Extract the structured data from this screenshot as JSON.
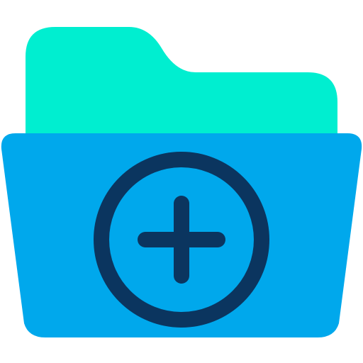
{
  "icon": {
    "name": "add-folder-icon",
    "glyph": "folder with plus sign"
  },
  "colors": {
    "folder_back": "#00EED0",
    "folder_front": "#00A8EC",
    "plus_and_ring": "#0B355F"
  }
}
